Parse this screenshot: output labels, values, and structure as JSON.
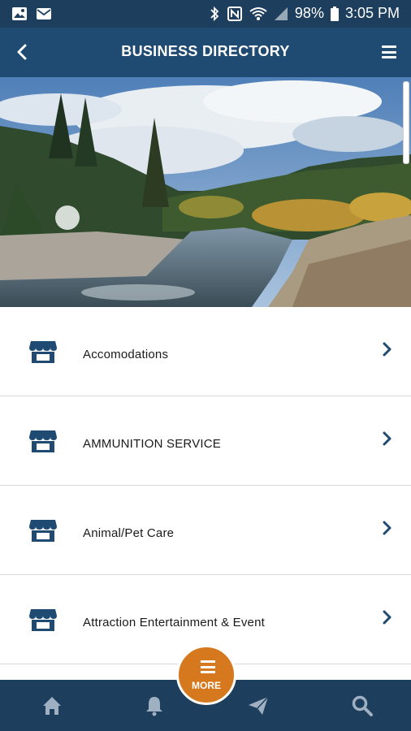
{
  "status_bar": {
    "battery": "98%",
    "time": "3:05 PM",
    "icons_left": [
      "image-icon",
      "mail-icon"
    ],
    "icons_right": [
      "bluetooth-icon",
      "nfc-icon",
      "wifi-icon",
      "signal-icon",
      "battery-icon"
    ]
  },
  "header": {
    "title": "BUSINESS DIRECTORY",
    "back_icon": "back-icon",
    "menu_icon": "hamburger-menu-icon"
  },
  "hero": {
    "description": "River landscape banner"
  },
  "directory": {
    "items": [
      {
        "label": "Accomodations"
      },
      {
        "label": "AMMUNITION SERVICE"
      },
      {
        "label": "Animal/Pet Care"
      },
      {
        "label": "Attraction Entertainment & Event"
      }
    ]
  },
  "bottom_nav": {
    "more_label": "MORE",
    "items": [
      "home-icon",
      "bell-icon",
      "send-icon",
      "search-icon"
    ]
  },
  "colors": {
    "header_bg": "#1f4a72",
    "status_bg": "#1d3e5c",
    "accent": "#d6781e",
    "icon_blue": "#1f4a72"
  }
}
